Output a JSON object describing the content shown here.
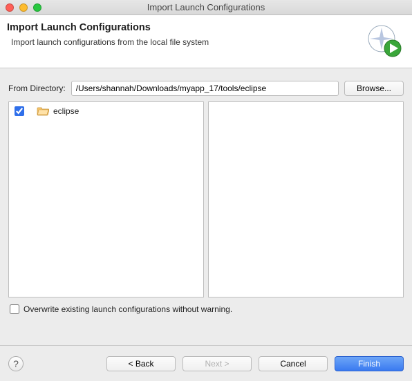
{
  "window": {
    "title": "Import Launch Configurations"
  },
  "header": {
    "title": "Import Launch Configurations",
    "subtitle": "Import launch configurations from the local file system"
  },
  "from": {
    "label": "From Directory:",
    "value": "/Users/shannah/Downloads/myapp_17/tools/eclipse",
    "browse_label": "Browse..."
  },
  "tree": {
    "items": [
      {
        "checked": true,
        "label": "eclipse"
      }
    ]
  },
  "options": {
    "overwrite_label": "Overwrite existing launch configurations without warning.",
    "overwrite_checked": false
  },
  "footer": {
    "help_symbol": "?",
    "back_label": "< Back",
    "next_label": "Next >",
    "cancel_label": "Cancel",
    "finish_label": "Finish"
  }
}
